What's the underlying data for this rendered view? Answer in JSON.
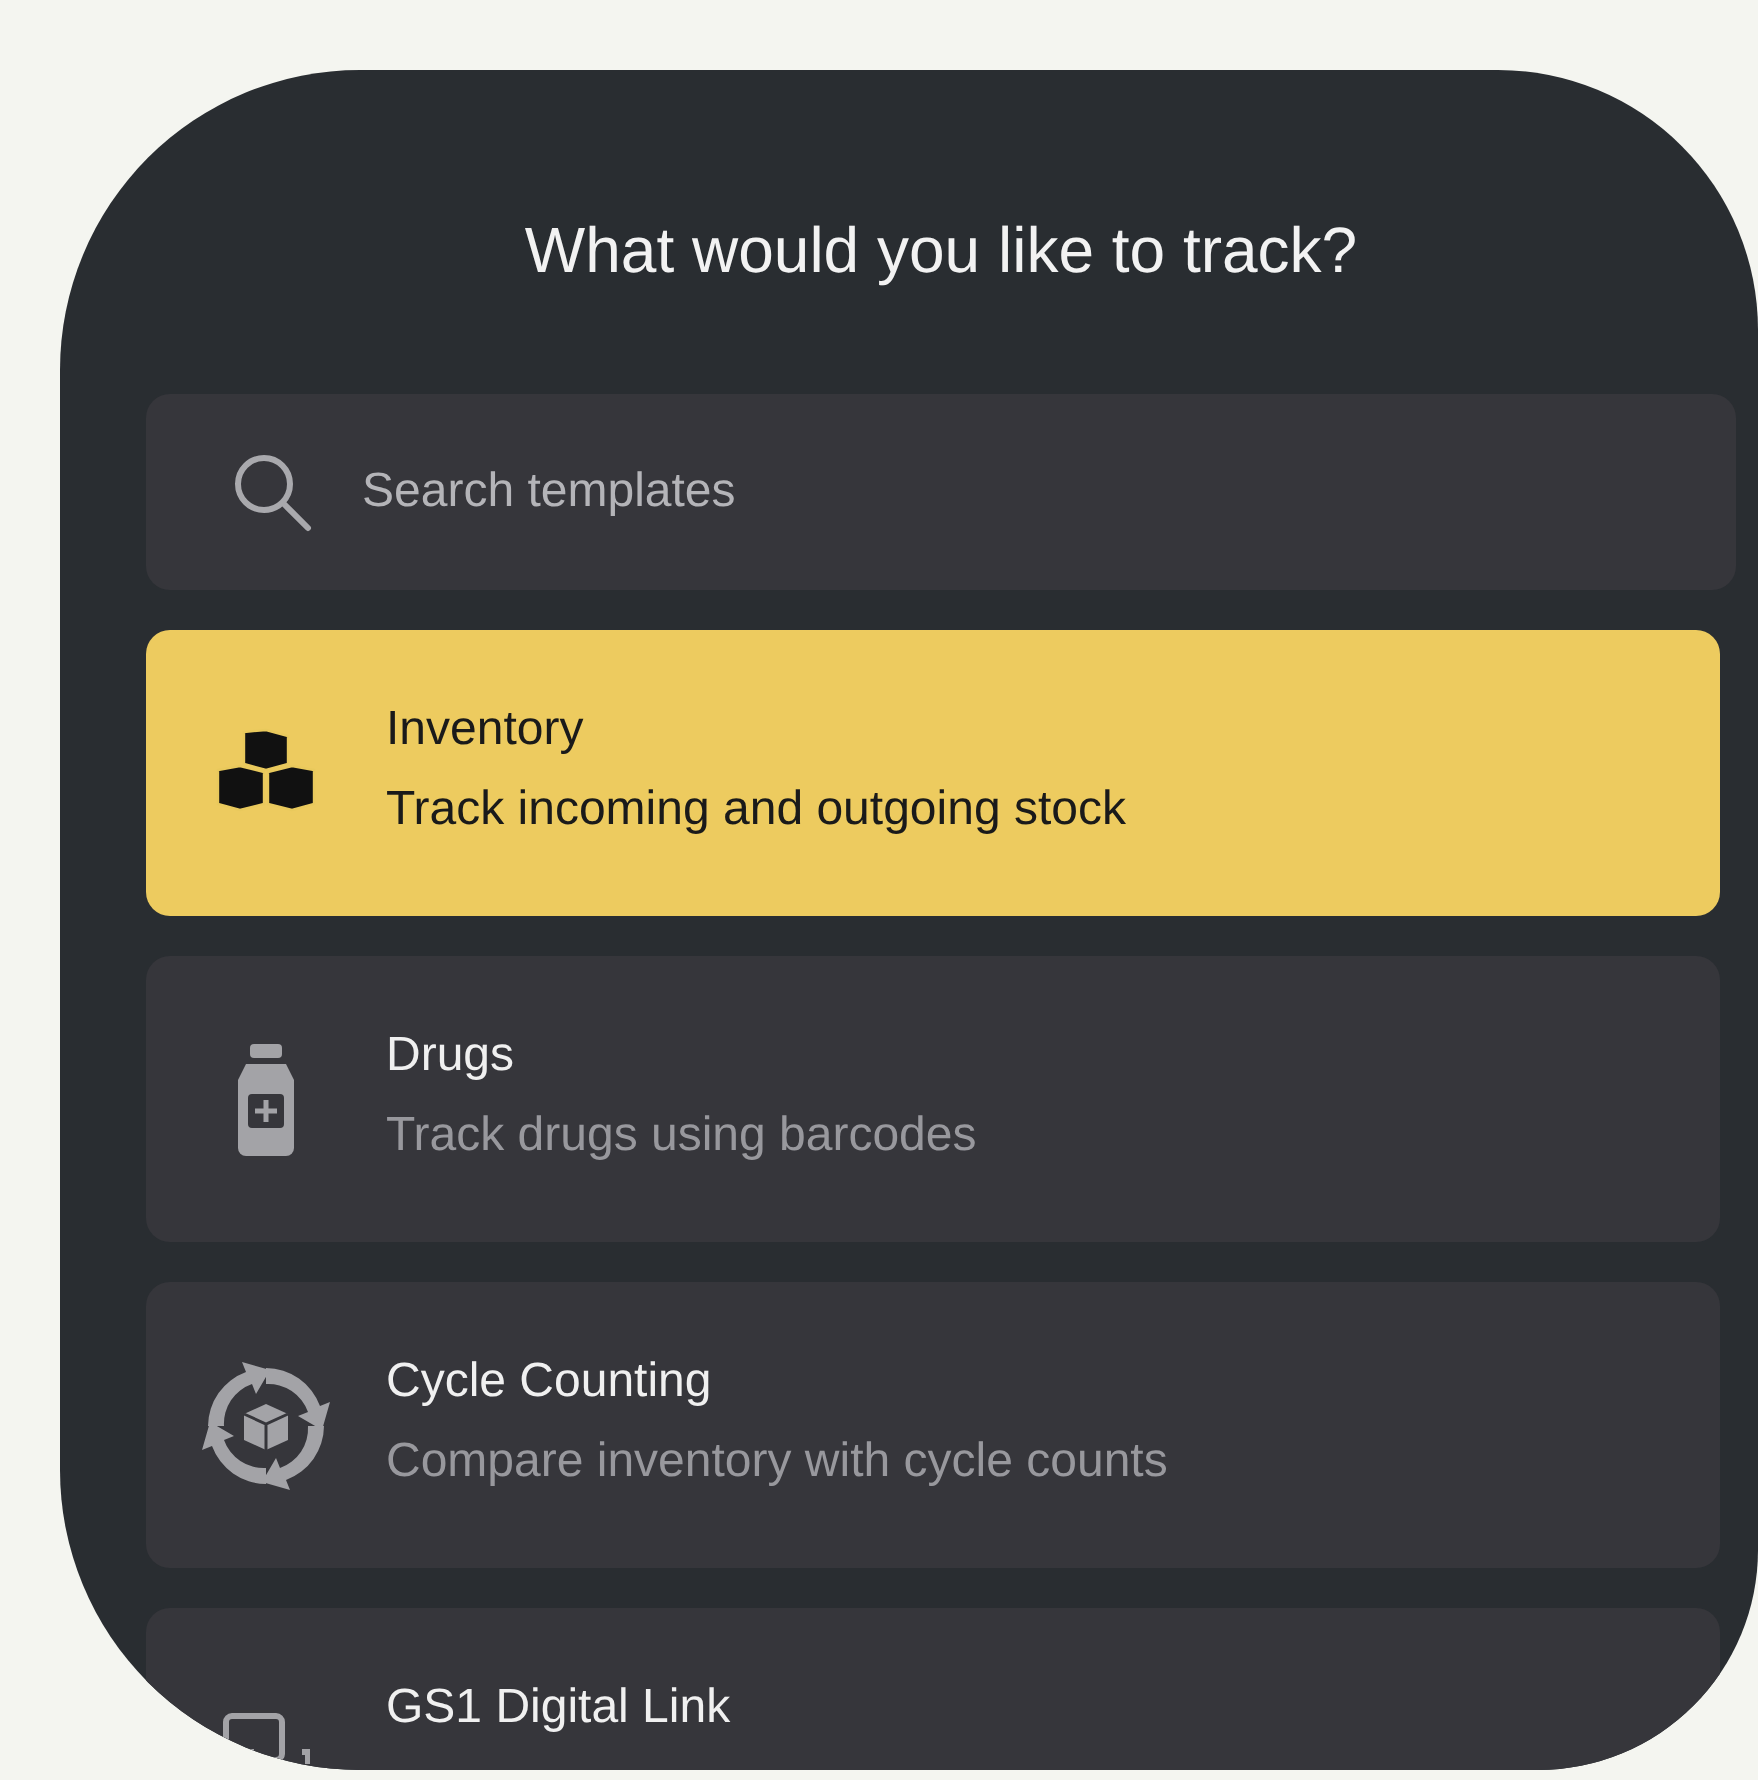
{
  "title": "What would you like to track?",
  "search": {
    "placeholder": "Search templates"
  },
  "templates": [
    {
      "kind": "boxes",
      "name": "Inventory",
      "description": "Track incoming and outgoing stock",
      "selected": true
    },
    {
      "kind": "bottle",
      "name": "Drugs",
      "description": "Track drugs using barcodes",
      "selected": false
    },
    {
      "kind": "cycle",
      "name": "Cycle Counting",
      "description": "Compare inventory with cycle counts",
      "selected": false
    },
    {
      "kind": "scan",
      "name": "GS1 Digital Link",
      "selected": false
    }
  ]
}
